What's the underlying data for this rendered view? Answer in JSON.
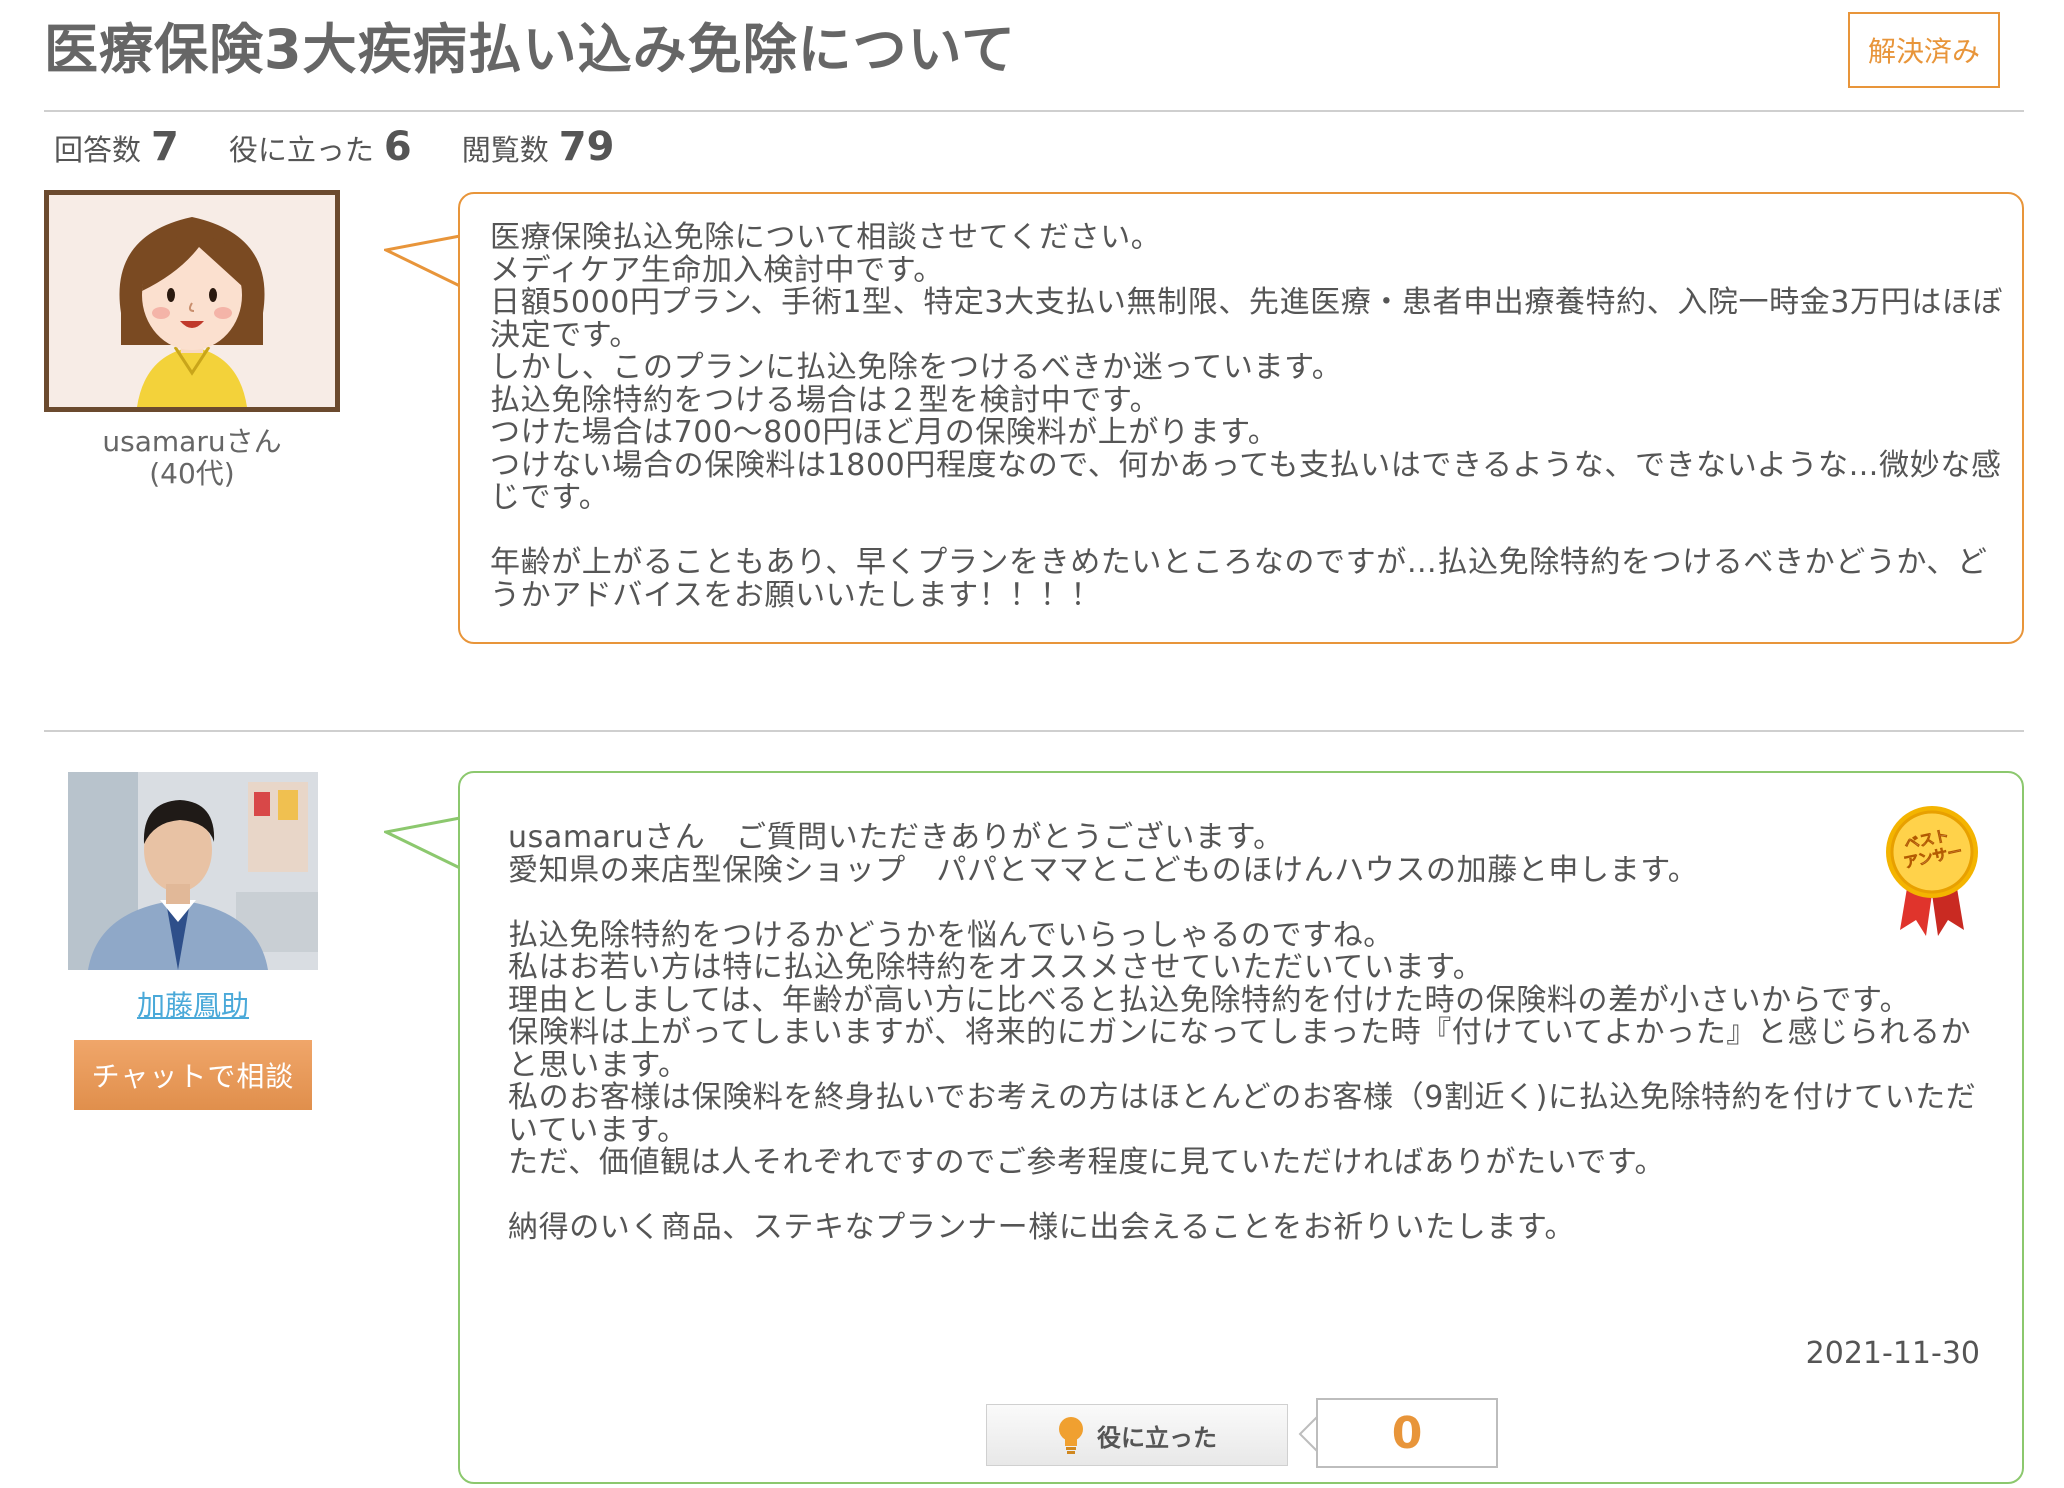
{
  "question": {
    "title": "医療保険3大疾病払い込み免除について",
    "status_badge": "解決済み",
    "stats": [
      {
        "label": "回答数",
        "value": "7"
      },
      {
        "label": "役に立った",
        "value": "6"
      },
      {
        "label": "閲覧数",
        "value": "79"
      }
    ],
    "asker": {
      "name": "usamaruさん",
      "age": "(40代)"
    },
    "body": "医療保険払込免除について相談させてください。\nメディケア生命加入検討中です。\n日額5000円プラン、手術1型、特定3大支払い無制限、先進医療・患者申出療養特約、入院一時金3万円はほぼ決定です。\nしかし、このプランに払込免除をつけるべきか迷っています。\n払込免除特約をつける場合は２型を検討中です。\nつけた場合は700〜800円ほど月の保険料が上がります。\nつけない場合の保険料は1800円程度なので、何かあっても支払いはできるような、できないような…微妙な感じです。\n\n年齢が上がることもあり、早くプランをきめたいところなのですが…払込免除特約をつけるべきかどうか、どうかアドバイスをお願いいたします！！！！"
  },
  "answer": {
    "answerer_name": "加藤鳳助",
    "chat_button": "チャットで相談",
    "best_answer_label": "ベスト\nアンサー",
    "body": "usamaruさん　ご質問いただきありがとうございます。\n愛知県の来店型保険ショップ　パパとママとこどものほけんハウスの加藤と申します。\n\n払込免除特約をつけるかどうかを悩んでいらっしゃるのですね。\n私はお若い方は特に払込免除特約をオススメさせていただいています。\n理由としましては、年齢が高い方に比べると払込免除特約を付けた時の保険料の差が小さいからです。\n保険料は上がってしまいますが、将来的にガンになってしまった時『付けていてよかった』と感じられるかと思います。\n私のお客様は保険料を終身払いでお考えの方はほとんどのお客様（9割近く)に払込免除特約を付けていただいています。\nただ、価値観は人それぞれですのでご参考程度に見ていただければありがたいです。\n\n納得のいく商品、ステキなプランナー様に出会えることをお祈りいたします。",
    "date": "2021-11-30",
    "helpful_label": "役に立った",
    "helpful_count": "0"
  },
  "colors": {
    "accent_orange": "#e8953a",
    "answer_green": "#8cc86e",
    "link_blue": "#4aa9d9"
  }
}
